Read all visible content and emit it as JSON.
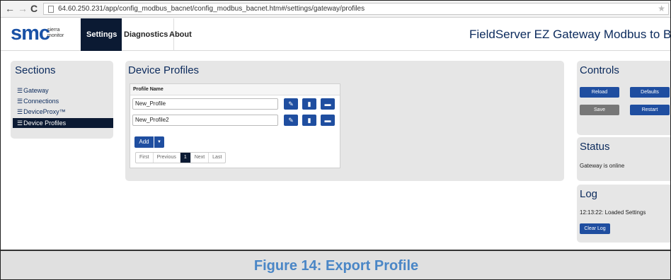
{
  "browser": {
    "url": "64.60.250.231/app/config_modbus_bacnet/config_modbus_bacnet.htm#/settings/gateway/profiles",
    "back_glyph": "←",
    "forward_glyph": "→",
    "reload_glyph": "C",
    "star_glyph": "★"
  },
  "header": {
    "logo_text": "smc",
    "logo_sub_line1": "sierra",
    "logo_sub_line2": "monitor",
    "tabs": [
      {
        "label": "Settings",
        "active": true
      },
      {
        "label": "Diagnostics",
        "active": false
      },
      {
        "label": "About",
        "active": false
      }
    ],
    "app_title": "FieldServer EZ Gateway Modbus to BACnet"
  },
  "sections": {
    "title": "Sections",
    "items": [
      {
        "label": "Gateway",
        "active": false,
        "icon": "list-icon"
      },
      {
        "label": "Connections",
        "active": false,
        "icon": "list-icon"
      },
      {
        "label": "DeviceProxy™",
        "active": false,
        "icon": "list-icon"
      },
      {
        "label": "Device Profiles",
        "active": true,
        "icon": "list-icon"
      }
    ]
  },
  "device_profiles": {
    "title": "Device Profiles",
    "column_header": "Profile Name",
    "rows": [
      {
        "name": "New_Profile"
      },
      {
        "name": "New_Profile2"
      }
    ],
    "row_buttons": [
      "edit-icon",
      "delete-icon",
      "export-icon"
    ],
    "add_label": "Add",
    "pager": [
      "First",
      "Previous",
      "1",
      "Next",
      "Last"
    ],
    "current_page": "1"
  },
  "controls": {
    "title": "Controls",
    "reload": "Reload",
    "defaults": "Defaults",
    "save": "Save",
    "restart": "Restart"
  },
  "status": {
    "title": "Status",
    "text": "Gateway is online"
  },
  "log": {
    "title": "Log",
    "entry": "12:13:22: Loaded Settings",
    "clear_label": "Clear Log"
  },
  "caption": "Figure 14: Export Profile",
  "colors": {
    "navy": "#0b1a33",
    "button_blue": "#1f4ea0",
    "title_blue": "#0b2a5c",
    "caption_blue": "#4a86c6"
  }
}
